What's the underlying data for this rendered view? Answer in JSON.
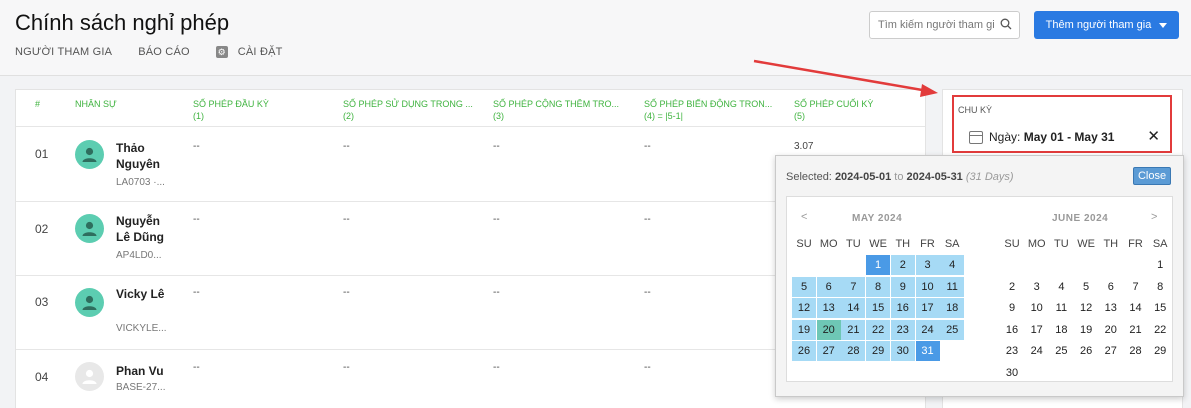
{
  "header": {
    "title": "Chính sách nghỉ phép",
    "tabs": [
      "NGƯỜI THAM GIA",
      "BÁO CÁO",
      "CÀI ĐẶT"
    ],
    "search_placeholder": "Tìm kiếm người tham gia",
    "add_button": "Thêm người tham gia"
  },
  "table": {
    "columns": [
      {
        "line1": "#",
        "line2": ""
      },
      {
        "line1": "NHÂN SỰ",
        "line2": ""
      },
      {
        "line1": "SỐ PHÉP ĐẦU KỲ",
        "line2": "(1)"
      },
      {
        "line1": "SỐ PHÉP SỬ DỤNG TRONG ...",
        "line2": "(2)"
      },
      {
        "line1": "SỐ PHÉP CỘNG THÊM TRO...",
        "line2": "(3)"
      },
      {
        "line1": "SỐ PHÉP BIẾN ĐỘNG TRON...",
        "line2": "(4) = |5-1|"
      },
      {
        "line1": "SỐ PHÉP CUỐI KỲ",
        "line2": "(5)"
      }
    ],
    "rows": [
      {
        "idx": "01",
        "name": "Thảo Nguyên",
        "code": "LA0703 ·...",
        "c1": "--",
        "c2": "--",
        "c3": "--",
        "c4": "--",
        "c5": "3.07"
      },
      {
        "idx": "02",
        "name": "Nguyễn Lê Dũng",
        "code": "AP4LD0...",
        "c1": "--",
        "c2": "--",
        "c3": "--",
        "c4": "--",
        "c5": ""
      },
      {
        "idx": "03",
        "name": "Vicky Lê",
        "code": "VICKYLE...",
        "c1": "--",
        "c2": "--",
        "c3": "--",
        "c4": "--",
        "c5": ""
      },
      {
        "idx": "04",
        "name": "Phan Vu",
        "code": "BASE-27...",
        "c1": "--",
        "c2": "--",
        "c3": "--",
        "c4": "--",
        "c5": ""
      }
    ]
  },
  "period": {
    "label": "CHU KỲ",
    "prefix": "Ngày:",
    "value": "May 01 - May 31",
    "close": "✕"
  },
  "datepicker": {
    "selected_label": "Selected:",
    "start": "2024-05-01",
    "to": "to",
    "end": "2024-05-31",
    "days": "(31 Days)",
    "close_button": "Close",
    "prev": "<",
    "next": ">",
    "weekdays": [
      "SU",
      "MO",
      "TU",
      "WE",
      "TH",
      "FR",
      "SA"
    ],
    "months": [
      {
        "title": "MAY 2024",
        "first_weekday": 3,
        "days": 31
      },
      {
        "title": "JUNE 2024",
        "first_weekday": 6,
        "days": 30
      }
    ]
  },
  "colors": {
    "accent": "#2a7ae2",
    "header_green": "#3fb33f",
    "highlight_red": "#e23b3b",
    "range": "#a6daf5",
    "endpoint": "#4a9ae6",
    "today": "#6ec7b5"
  }
}
